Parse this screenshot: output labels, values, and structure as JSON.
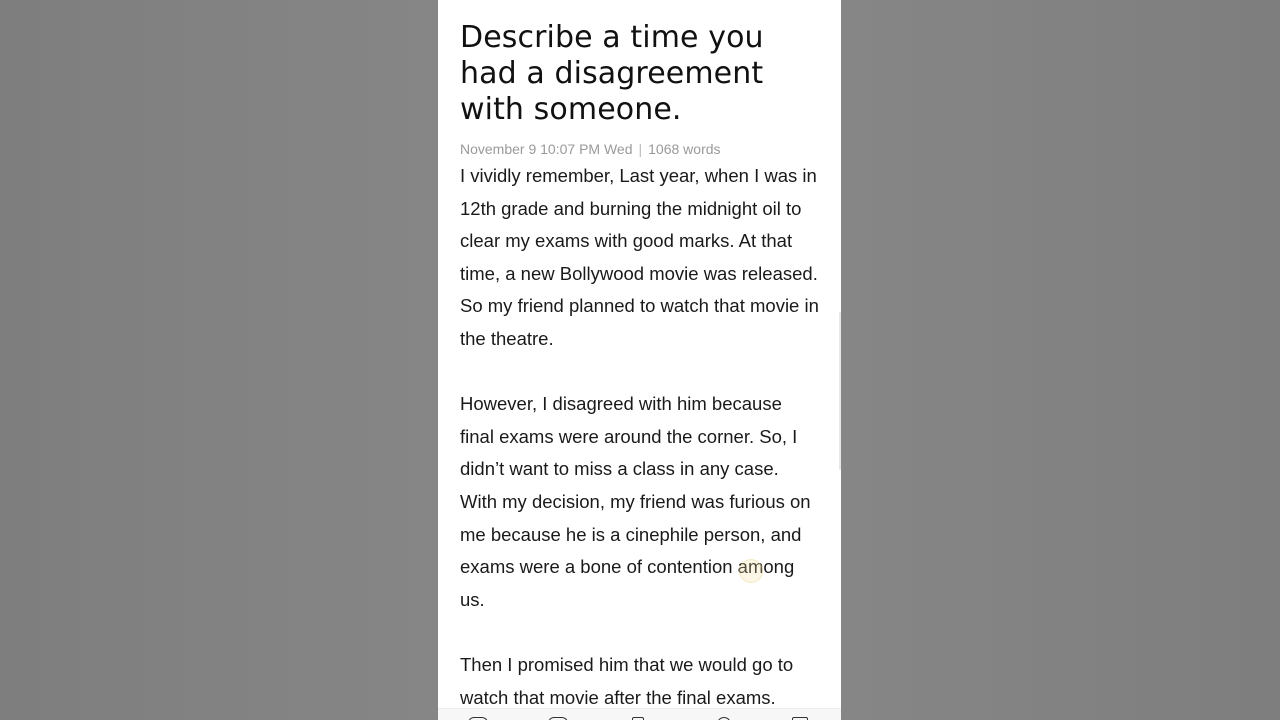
{
  "note": {
    "title": "Describe a time you had a disagreement with someone.",
    "date": "November 9 10:07 PM Wed",
    "separator": "|",
    "word_count": "1068 words",
    "paragraphs": [
      "I vividly remember, Last year, when I was in 12th grade and burning the midnight oil to clear my exams with good marks. At that time, a new Bollywood movie was released. So my friend planned to watch that movie in the theatre.",
      "However, I disagreed with him because final exams were around the corner. So, I didn’t want to miss a class in any case. With my decision, my friend was furious on me because he is a cinephile person, and exams were a bone of contention among us.",
      "Then I promised him that we would go to watch that movie after the final exams."
    ]
  },
  "toolbar": {
    "icons": [
      "palette-icon",
      "brush-icon",
      "bookmark-icon",
      "search-icon",
      "delete-icon"
    ]
  }
}
